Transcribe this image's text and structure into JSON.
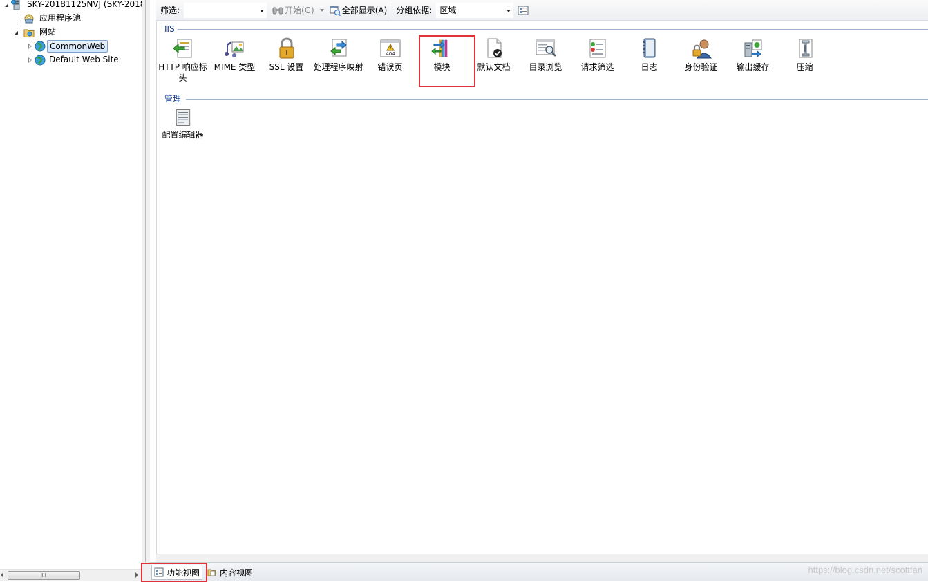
{
  "tree": {
    "server_label": "SKY-20181125NVJ (SKY-2018",
    "app_pools_label": "应用程序池",
    "sites_label": "网站",
    "sites": [
      {
        "label": "CommonWeb",
        "selected": true
      },
      {
        "label": "Default Web Site",
        "selected": false
      }
    ],
    "scroll_thumb_label": "III"
  },
  "toolbar": {
    "filter_label": "筛选:",
    "filter_value": "",
    "start_label": "开始(G)",
    "show_all_label": "全部显示(A)",
    "group_by_label": "分组依据:",
    "group_by_value": "区域"
  },
  "groups": {
    "iis": {
      "title": "IIS",
      "features": [
        {
          "label": "HTTP 响应标头",
          "icon": "http-response-headers-icon"
        },
        {
          "label": "MIME 类型",
          "icon": "mime-types-icon"
        },
        {
          "label": "SSL 设置",
          "icon": "ssl-lock-icon"
        },
        {
          "label": "处理程序映射",
          "icon": "handler-mappings-icon"
        },
        {
          "label": "错误页",
          "icon": "error-pages-icon"
        },
        {
          "label": "模块",
          "icon": "modules-icon"
        },
        {
          "label": "默认文档",
          "icon": "default-document-icon"
        },
        {
          "label": "目录浏览",
          "icon": "directory-browsing-icon"
        },
        {
          "label": "请求筛选",
          "icon": "request-filtering-icon"
        },
        {
          "label": "日志",
          "icon": "logging-icon"
        },
        {
          "label": "身份验证",
          "icon": "authentication-icon"
        },
        {
          "label": "输出缓存",
          "icon": "output-caching-icon"
        },
        {
          "label": "压缩",
          "icon": "compression-icon"
        }
      ]
    },
    "management": {
      "title": "管理",
      "features": [
        {
          "label": "配置编辑器",
          "icon": "configuration-editor-icon"
        }
      ]
    }
  },
  "error_icon_text": "404",
  "view_tabs": {
    "features_view": "功能视图",
    "content_view": "内容视图"
  },
  "watermark": "https://blog.csdn.net/scottfan",
  "colors": {
    "highlight_red": "#e0323a",
    "group_header_blue": "#1a3e8c"
  }
}
